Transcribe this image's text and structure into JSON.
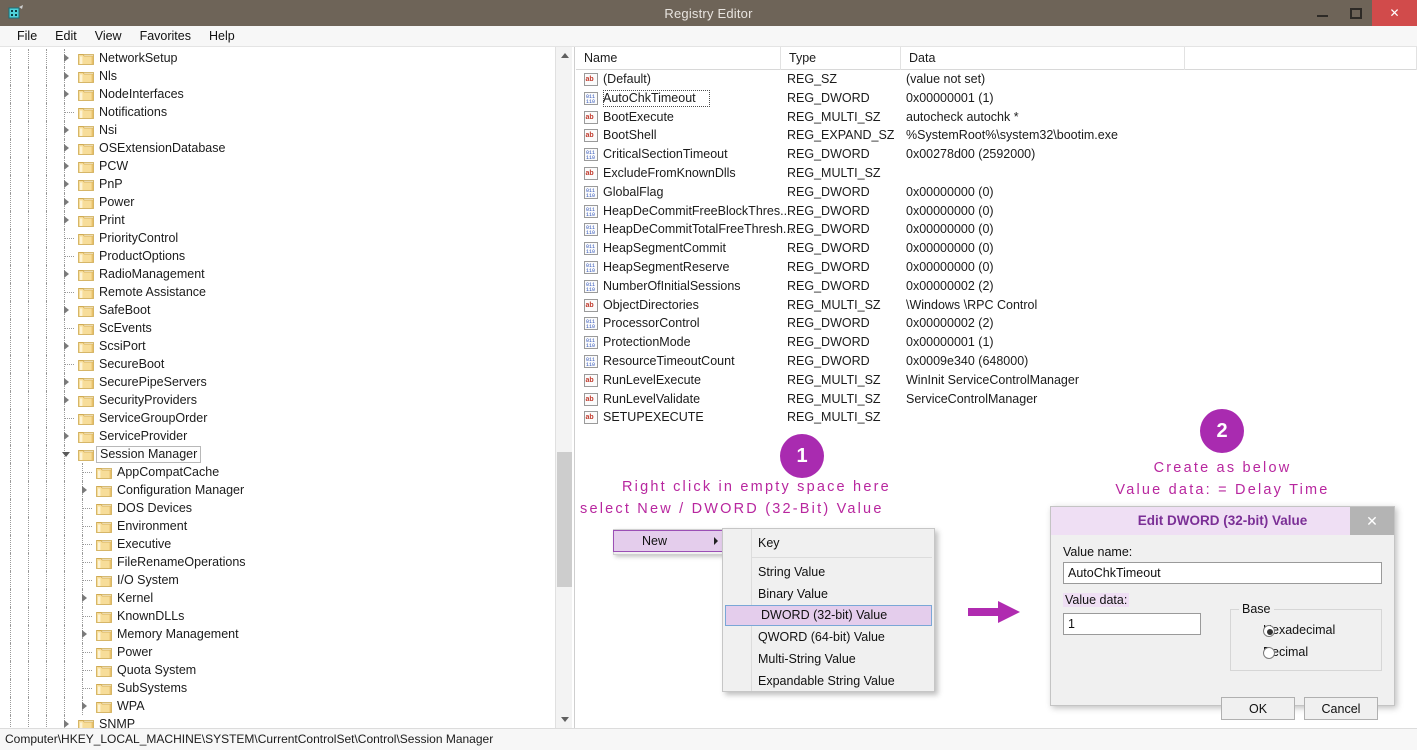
{
  "window": {
    "title": "Registry Editor",
    "app_icon": "registry-editor-icon",
    "minimize_label": "–",
    "maximize_label": "❑",
    "close_label": "✕"
  },
  "menubar": {
    "items": [
      {
        "label": "File"
      },
      {
        "label": "Edit"
      },
      {
        "label": "View"
      },
      {
        "label": "Favorites"
      },
      {
        "label": "Help"
      }
    ]
  },
  "tree": {
    "items": [
      {
        "label": "NetworkSetup",
        "depth": 4,
        "arrow": "collapsed",
        "selected": false
      },
      {
        "label": "Nls",
        "depth": 4,
        "arrow": "collapsed",
        "selected": false
      },
      {
        "label": "NodeInterfaces",
        "depth": 4,
        "arrow": "collapsed",
        "selected": false
      },
      {
        "label": "Notifications",
        "depth": 4,
        "arrow": "none",
        "selected": false
      },
      {
        "label": "Nsi",
        "depth": 4,
        "arrow": "collapsed",
        "selected": false
      },
      {
        "label": "OSExtensionDatabase",
        "depth": 4,
        "arrow": "collapsed",
        "selected": false
      },
      {
        "label": "PCW",
        "depth": 4,
        "arrow": "collapsed",
        "selected": false
      },
      {
        "label": "PnP",
        "depth": 4,
        "arrow": "collapsed",
        "selected": false
      },
      {
        "label": "Power",
        "depth": 4,
        "arrow": "collapsed",
        "selected": false
      },
      {
        "label": "Print",
        "depth": 4,
        "arrow": "collapsed",
        "selected": false
      },
      {
        "label": "PriorityControl",
        "depth": 4,
        "arrow": "none",
        "selected": false
      },
      {
        "label": "ProductOptions",
        "depth": 4,
        "arrow": "none",
        "selected": false
      },
      {
        "label": "RadioManagement",
        "depth": 4,
        "arrow": "collapsed",
        "selected": false
      },
      {
        "label": "Remote Assistance",
        "depth": 4,
        "arrow": "none",
        "selected": false
      },
      {
        "label": "SafeBoot",
        "depth": 4,
        "arrow": "collapsed",
        "selected": false
      },
      {
        "label": "ScEvents",
        "depth": 4,
        "arrow": "none",
        "selected": false
      },
      {
        "label": "ScsiPort",
        "depth": 4,
        "arrow": "collapsed",
        "selected": false
      },
      {
        "label": "SecureBoot",
        "depth": 4,
        "arrow": "none",
        "selected": false
      },
      {
        "label": "SecurePipeServers",
        "depth": 4,
        "arrow": "collapsed",
        "selected": false
      },
      {
        "label": "SecurityProviders",
        "depth": 4,
        "arrow": "collapsed",
        "selected": false
      },
      {
        "label": "ServiceGroupOrder",
        "depth": 4,
        "arrow": "none",
        "selected": false
      },
      {
        "label": "ServiceProvider",
        "depth": 4,
        "arrow": "collapsed",
        "selected": false
      },
      {
        "label": "Session Manager",
        "depth": 4,
        "arrow": "expanded",
        "selected": true
      },
      {
        "label": "AppCompatCache",
        "depth": 5,
        "arrow": "none",
        "selected": false
      },
      {
        "label": "Configuration Manager",
        "depth": 5,
        "arrow": "collapsed",
        "selected": false
      },
      {
        "label": "DOS Devices",
        "depth": 5,
        "arrow": "none",
        "selected": false
      },
      {
        "label": "Environment",
        "depth": 5,
        "arrow": "none",
        "selected": false
      },
      {
        "label": "Executive",
        "depth": 5,
        "arrow": "none",
        "selected": false
      },
      {
        "label": "FileRenameOperations",
        "depth": 5,
        "arrow": "none",
        "selected": false
      },
      {
        "label": "I/O System",
        "depth": 5,
        "arrow": "none",
        "selected": false
      },
      {
        "label": "Kernel",
        "depth": 5,
        "arrow": "collapsed",
        "selected": false
      },
      {
        "label": "KnownDLLs",
        "depth": 5,
        "arrow": "none",
        "selected": false
      },
      {
        "label": "Memory Management",
        "depth": 5,
        "arrow": "collapsed",
        "selected": false
      },
      {
        "label": "Power",
        "depth": 5,
        "arrow": "none",
        "selected": false
      },
      {
        "label": "Quota System",
        "depth": 5,
        "arrow": "none",
        "selected": false
      },
      {
        "label": "SubSystems",
        "depth": 5,
        "arrow": "none",
        "selected": false
      },
      {
        "label": "WPA",
        "depth": 5,
        "arrow": "collapsed",
        "selected": false
      },
      {
        "label": "SNMP",
        "depth": 4,
        "arrow": "collapsed",
        "selected": false
      }
    ]
  },
  "list": {
    "columns": [
      {
        "label": "Name"
      },
      {
        "label": "Type"
      },
      {
        "label": "Data"
      },
      {
        "label": ""
      }
    ],
    "rows": [
      {
        "icon": "string-value-icon",
        "name": "(Default)",
        "type": "REG_SZ",
        "data": "(value not set)",
        "focused": false
      },
      {
        "icon": "dword-value-icon",
        "name": "AutoChkTimeout",
        "type": "REG_DWORD",
        "data": "0x00000001 (1)",
        "focused": true
      },
      {
        "icon": "string-value-icon",
        "name": "BootExecute",
        "type": "REG_MULTI_SZ",
        "data": "autocheck autochk *",
        "focused": false
      },
      {
        "icon": "string-value-icon",
        "name": "BootShell",
        "type": "REG_EXPAND_SZ",
        "data": "%SystemRoot%\\system32\\bootim.exe",
        "focused": false
      },
      {
        "icon": "dword-value-icon",
        "name": "CriticalSectionTimeout",
        "type": "REG_DWORD",
        "data": "0x00278d00 (2592000)",
        "focused": false
      },
      {
        "icon": "string-value-icon",
        "name": "ExcludeFromKnownDlls",
        "type": "REG_MULTI_SZ",
        "data": "",
        "focused": false
      },
      {
        "icon": "dword-value-icon",
        "name": "GlobalFlag",
        "type": "REG_DWORD",
        "data": "0x00000000 (0)",
        "focused": false
      },
      {
        "icon": "dword-value-icon",
        "name": "HeapDeCommitFreeBlockThres...",
        "type": "REG_DWORD",
        "data": "0x00000000 (0)",
        "focused": false
      },
      {
        "icon": "dword-value-icon",
        "name": "HeapDeCommitTotalFreeThresh...",
        "type": "REG_DWORD",
        "data": "0x00000000 (0)",
        "focused": false
      },
      {
        "icon": "dword-value-icon",
        "name": "HeapSegmentCommit",
        "type": "REG_DWORD",
        "data": "0x00000000 (0)",
        "focused": false
      },
      {
        "icon": "dword-value-icon",
        "name": "HeapSegmentReserve",
        "type": "REG_DWORD",
        "data": "0x00000000 (0)",
        "focused": false
      },
      {
        "icon": "dword-value-icon",
        "name": "NumberOfInitialSessions",
        "type": "REG_DWORD",
        "data": "0x00000002 (2)",
        "focused": false
      },
      {
        "icon": "string-value-icon",
        "name": "ObjectDirectories",
        "type": "REG_MULTI_SZ",
        "data": "\\Windows \\RPC Control",
        "focused": false
      },
      {
        "icon": "dword-value-icon",
        "name": "ProcessorControl",
        "type": "REG_DWORD",
        "data": "0x00000002 (2)",
        "focused": false
      },
      {
        "icon": "dword-value-icon",
        "name": "ProtectionMode",
        "type": "REG_DWORD",
        "data": "0x00000001 (1)",
        "focused": false
      },
      {
        "icon": "dword-value-icon",
        "name": "ResourceTimeoutCount",
        "type": "REG_DWORD",
        "data": "0x0009e340 (648000)",
        "focused": false
      },
      {
        "icon": "string-value-icon",
        "name": "RunLevelExecute",
        "type": "REG_MULTI_SZ",
        "data": "WinInit ServiceControlManager",
        "focused": false
      },
      {
        "icon": "string-value-icon",
        "name": "RunLevelValidate",
        "type": "REG_MULTI_SZ",
        "data": "ServiceControlManager",
        "focused": false
      },
      {
        "icon": "string-value-icon",
        "name": "SETUPEXECUTE",
        "type": "REG_MULTI_SZ",
        "data": "",
        "focused": false
      }
    ]
  },
  "annotations": {
    "step1": {
      "badge": "1",
      "line1": "Right click in empty space here",
      "line2": "select New / DWORD (32-Bit) Value"
    },
    "step2": {
      "badge": "2",
      "line1": "Create as below",
      "line2": "Value data: = Delay Time"
    },
    "arrow_icon": "right-arrow-icon",
    "accent_color": "#b8279f",
    "badge_color": "#a92bb0"
  },
  "context_menu": {
    "parent_label": "New",
    "submenu_arrow": "chevron-right-icon",
    "items": [
      {
        "label": "Key",
        "highlighted": false,
        "separator_after": true
      },
      {
        "label": "String Value",
        "highlighted": false,
        "separator_after": false
      },
      {
        "label": "Binary Value",
        "highlighted": false,
        "separator_after": false
      },
      {
        "label": "DWORD (32-bit) Value",
        "highlighted": true,
        "separator_after": false
      },
      {
        "label": "QWORD (64-bit) Value",
        "highlighted": false,
        "separator_after": false
      },
      {
        "label": "Multi-String Value",
        "highlighted": false,
        "separator_after": false
      },
      {
        "label": "Expandable String Value",
        "highlighted": false,
        "separator_after": false
      }
    ]
  },
  "dialog": {
    "title": "Edit DWORD (32-bit) Value",
    "close_label": "✕",
    "value_name_label": "Value name:",
    "value_name": "AutoChkTimeout",
    "value_data_label": "Value data:",
    "value_data": "1",
    "base_label": "Base",
    "base_options": [
      {
        "label": "Hexadecimal",
        "selected": true
      },
      {
        "label": "Decimal",
        "selected": false
      }
    ],
    "ok_label": "OK",
    "cancel_label": "Cancel"
  },
  "statusbar": {
    "path": "Computer\\HKEY_LOCAL_MACHINE\\SYSTEM\\CurrentControlSet\\Control\\Session Manager"
  }
}
